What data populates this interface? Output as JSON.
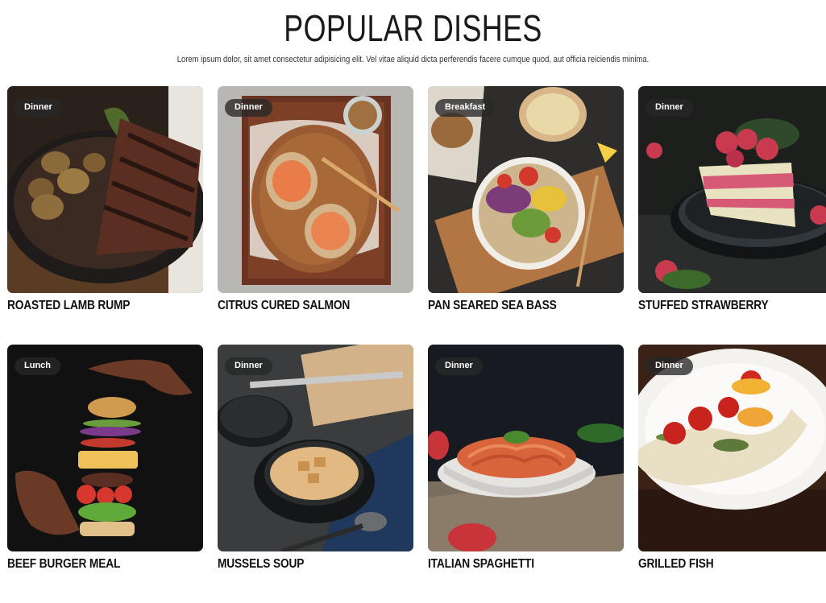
{
  "section": {
    "title": "POPULAR DISHES",
    "subtitle": "Lorem ipsum dolor, sit amet consectetur adipisicing elit. Vel vitae aliquid dicta perferendis facere cumque quod, aut officia reiciendis minima."
  },
  "dishes": [
    {
      "name": "ROASTED LAMB RUMP",
      "tag": "Dinner",
      "image": "lamb-rump-photo"
    },
    {
      "name": "CITRUS CURED SALMON",
      "tag": "Dinner",
      "image": "salmon-toast-photo"
    },
    {
      "name": "PAN SEARED SEA BASS",
      "tag": "Breakfast",
      "image": "salad-bowl-photo"
    },
    {
      "name": "STUFFED STRAWBERRY",
      "tag": "Dinner",
      "image": "strawberry-cake-photo"
    },
    {
      "name": "BEEF BURGER MEAL",
      "tag": "Lunch",
      "image": "floating-burger-photo"
    },
    {
      "name": "MUSSELS SOUP",
      "tag": "Dinner",
      "image": "soup-pot-photo"
    },
    {
      "name": "ITALIAN SPAGHETTI",
      "tag": "Dinner",
      "image": "spaghetti-plate-photo"
    },
    {
      "name": "GRILLED FISH",
      "tag": "Dinner",
      "image": "grilled-fish-photo"
    }
  ]
}
